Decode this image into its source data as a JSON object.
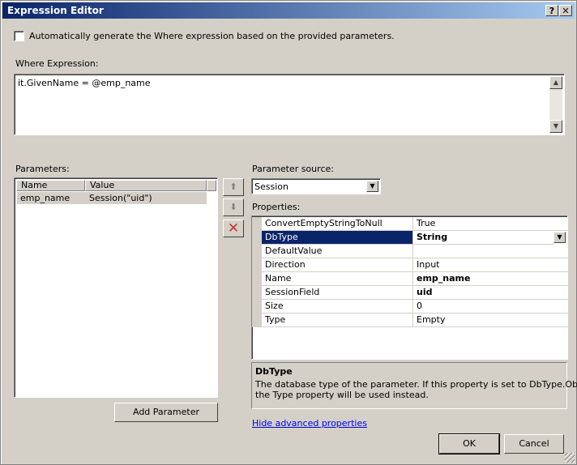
{
  "window": {
    "title": "Expression Editor",
    "help_btn": "?",
    "close_btn": "✕"
  },
  "auto_generate": {
    "label": "Automatically generate the Where expression based on the provided parameters.",
    "checked": false
  },
  "where": {
    "label": "Where Expression:",
    "value": "it.GivenName = @emp_name"
  },
  "parameters": {
    "label": "Parameters:",
    "columns": [
      "Name",
      "Value"
    ],
    "rows": [
      {
        "name": "emp_name",
        "value": "Session(\"uid\")"
      }
    ],
    "add_button": "Add Parameter"
  },
  "side_buttons": {
    "up_icon": "move-up-icon",
    "down_icon": "move-down-icon",
    "delete_icon": "delete-icon",
    "delete_color": "#c0392b"
  },
  "source": {
    "label": "Parameter source:",
    "value": "Session"
  },
  "properties": {
    "label": "Properties:",
    "rows": [
      {
        "name": "ConvertEmptyStringToNull",
        "value": "True",
        "bold": false
      },
      {
        "name": "DbType",
        "value": "String",
        "bold": true,
        "selected": true
      },
      {
        "name": "DefaultValue",
        "value": "",
        "bold": false
      },
      {
        "name": "Direction",
        "value": "Input",
        "bold": false
      },
      {
        "name": "Name",
        "value": "emp_name",
        "bold": true
      },
      {
        "name": "SessionField",
        "value": "uid",
        "bold": true
      },
      {
        "name": "Size",
        "value": "0",
        "bold": false
      },
      {
        "name": "Type",
        "value": "Empty",
        "bold": false
      }
    ]
  },
  "description": {
    "title": "DbType",
    "text_line1": "The database type of the parameter. If this property is set to DbType.Object,",
    "text_line2": "the Type property will be used instead."
  },
  "link": "Hide advanced properties",
  "buttons": {
    "ok": "OK",
    "cancel": "Cancel"
  },
  "colors": {
    "title_start": "#0a246a",
    "title_end": "#a6caf0",
    "selection": "#0a246a",
    "link": "#0000ee"
  }
}
